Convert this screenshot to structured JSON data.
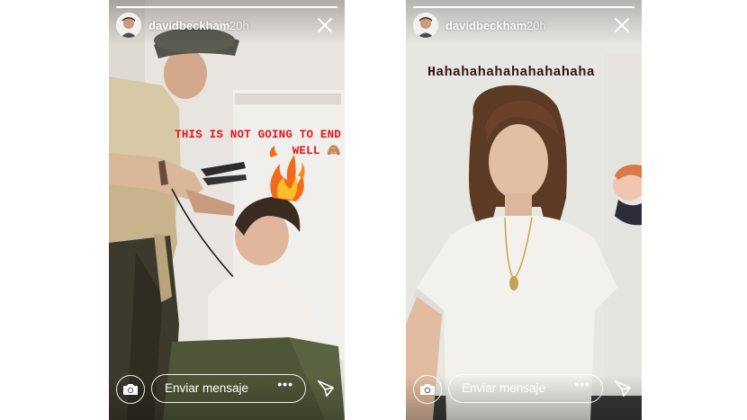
{
  "stories": [
    {
      "username": "davidbeckham",
      "time": "20h",
      "caption": "THIS IS NOT GOING TO END WELL",
      "caption_emoji": "🙈",
      "message_placeholder": "Enviar mensaje",
      "more_label": "•••",
      "caption_color": "#e4141b"
    },
    {
      "username": "davidbeckham",
      "time": "20h",
      "caption": "Hahahahahahahahahaha",
      "message_placeholder": "Enviar mensaje",
      "more_label": "•••",
      "caption_color": "#3a1414"
    }
  ],
  "icons": {
    "close": "close-icon",
    "camera": "camera-icon",
    "send": "send-icon",
    "fire": "fire-icon",
    "avatar": "avatar"
  }
}
